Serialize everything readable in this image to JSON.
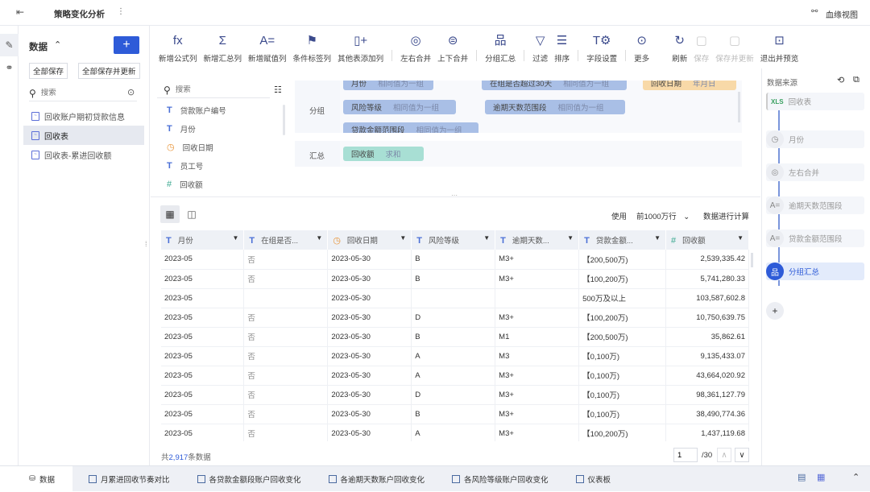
{
  "header": {
    "title": "策略变化分析",
    "lineage": "血缘视图"
  },
  "left": {
    "title": "数据",
    "save_all": "全部保存",
    "save_all_update": "全部保存并更新",
    "search_placeholder": "搜索",
    "datasets": [
      "回收账户期初贷款信息",
      "回收表",
      "回收表-累进回收额"
    ],
    "selected": 1
  },
  "toolbar": [
    {
      "label": "新增公式列",
      "icon": "fx-icon",
      "g": "fx"
    },
    {
      "label": "新增汇总列",
      "icon": "sigma-icon",
      "g": "Σ"
    },
    {
      "label": "新增赋值列",
      "icon": "assign-icon",
      "g": "A="
    },
    {
      "label": "条件标签列",
      "icon": "flag-icon",
      "g": "⚑"
    },
    {
      "label": "其他表添加列",
      "icon": "add-column-icon",
      "g": "▯+"
    },
    {
      "sep": true
    },
    {
      "label": "左右合并",
      "icon": "merge-lr-icon",
      "g": "◎"
    },
    {
      "label": "上下合并",
      "icon": "merge-tb-icon",
      "g": "⊜"
    },
    {
      "sep": true
    },
    {
      "label": "分组汇总",
      "icon": "group-icon",
      "g": "品"
    },
    {
      "sep": true
    },
    {
      "label": "过滤",
      "icon": "filter-icon",
      "g": "▽"
    },
    {
      "label": "排序",
      "icon": "sort-icon",
      "g": "☰"
    },
    {
      "sep": true
    },
    {
      "label": "字段设置",
      "icon": "field-settings-icon",
      "g": "T⚙"
    },
    {
      "sep": true
    },
    {
      "label": "更多",
      "icon": "more-icon",
      "g": "⊙"
    },
    {
      "label": "刷新",
      "icon": "refresh-icon",
      "g": "↻",
      "space": true
    },
    {
      "label": "保存",
      "icon": "save-icon",
      "g": "▢",
      "disabled": true
    },
    {
      "label": "保存并更新",
      "icon": "save-update-icon",
      "g": "▢",
      "disabled": true
    },
    {
      "label": "退出并预览",
      "icon": "exit-preview-icon",
      "g": "⊡"
    }
  ],
  "fields": {
    "search_placeholder": "搜索",
    "items": [
      {
        "name": "贷款账户编号",
        "type": "text"
      },
      {
        "name": "月份",
        "type": "text"
      },
      {
        "name": "回收日期",
        "type": "date"
      },
      {
        "name": "员工号",
        "type": "text"
      },
      {
        "name": "回收额",
        "type": "number"
      }
    ]
  },
  "config": {
    "group_label": "分组",
    "summary_label": "汇总",
    "groups": [
      {
        "name": "月份",
        "mode": "相同值为一组"
      },
      {
        "name": "在组是否超过30天",
        "mode": "相同值为一组"
      },
      {
        "name": "回收日期",
        "mode": "年月日",
        "color": "#f8d9a8"
      },
      {
        "name": "风险等级",
        "mode": "相同值为一组"
      },
      {
        "name": "逾期天数范围段",
        "mode": "相同值为一组"
      },
      {
        "name": "贷款金额范围段",
        "mode": "相同值为一组"
      }
    ],
    "summary": [
      {
        "name": "回收额",
        "mode": "求和",
        "color": "#a8dfd4"
      }
    ]
  },
  "table_bar": {
    "use": "使用",
    "rows_option": "前1000万行",
    "compute": "数据进行计算"
  },
  "table": {
    "columns": [
      {
        "name": "月份",
        "type": "text"
      },
      {
        "name": "在组是否...",
        "type": "text"
      },
      {
        "name": "回收日期",
        "type": "date"
      },
      {
        "name": "风险等级",
        "type": "text"
      },
      {
        "name": "逾期天数...",
        "type": "text"
      },
      {
        "name": "贷款金额...",
        "type": "text"
      },
      {
        "name": "回收额",
        "type": "number"
      }
    ],
    "rows": [
      [
        "2023-05",
        "否",
        "2023-05-30",
        "B",
        "M3+",
        "【200,500万)",
        "2,539,335.42"
      ],
      [
        "2023-05",
        "否",
        "2023-05-30",
        "B",
        "M3+",
        "【100,200万)",
        "5,741,280.33"
      ],
      [
        "2023-05",
        "",
        "2023-05-30",
        "",
        "",
        "500万及以上",
        "103,587,602.8"
      ],
      [
        "2023-05",
        "否",
        "2023-05-30",
        "D",
        "M3+",
        "【100,200万)",
        "10,750,639.75"
      ],
      [
        "2023-05",
        "否",
        "2023-05-30",
        "B",
        "M1",
        "【200,500万)",
        "35,862.61"
      ],
      [
        "2023-05",
        "否",
        "2023-05-30",
        "A",
        "M3",
        "【0,100万)",
        "9,135,433.07"
      ],
      [
        "2023-05",
        "否",
        "2023-05-30",
        "A",
        "M3+",
        "【0,100万)",
        "43,664,020.92"
      ],
      [
        "2023-05",
        "否",
        "2023-05-30",
        "D",
        "M3+",
        "【0,100万)",
        "98,361,127.79"
      ],
      [
        "2023-05",
        "否",
        "2023-05-30",
        "B",
        "M3+",
        "【0,100万)",
        "38,490,774.36"
      ],
      [
        "2023-05",
        "否",
        "2023-05-30",
        "A",
        "M3+",
        "【100,200万)",
        "1,437,119.68"
      ]
    ]
  },
  "footer": {
    "prefix": "共",
    "count": "2,917",
    "suffix": "条数据",
    "page": "1",
    "total_pages": "/30"
  },
  "right": {
    "title": "数据来源",
    "source_badge": "XLS",
    "source": "回收表",
    "steps": [
      {
        "label": "月份",
        "g": "◷"
      },
      {
        "label": "左右合并",
        "g": "◎"
      },
      {
        "label": "逾期天数范围段",
        "g": "A="
      },
      {
        "label": "贷款金额范围段",
        "g": "A="
      },
      {
        "label": "分组汇总",
        "g": "品",
        "active": true
      }
    ]
  },
  "tabs": [
    {
      "label": "数据",
      "active": true
    },
    {
      "label": "月累进回收节奏对比"
    },
    {
      "label": "各贷款金额段账户回收变化"
    },
    {
      "label": "各逾期天数账户回收变化"
    },
    {
      "label": "各风险等级账户回收变化"
    },
    {
      "label": "仪表板"
    }
  ],
  "colors": {
    "accent": "#2e5bd8",
    "chip": "#a9bfe6"
  }
}
